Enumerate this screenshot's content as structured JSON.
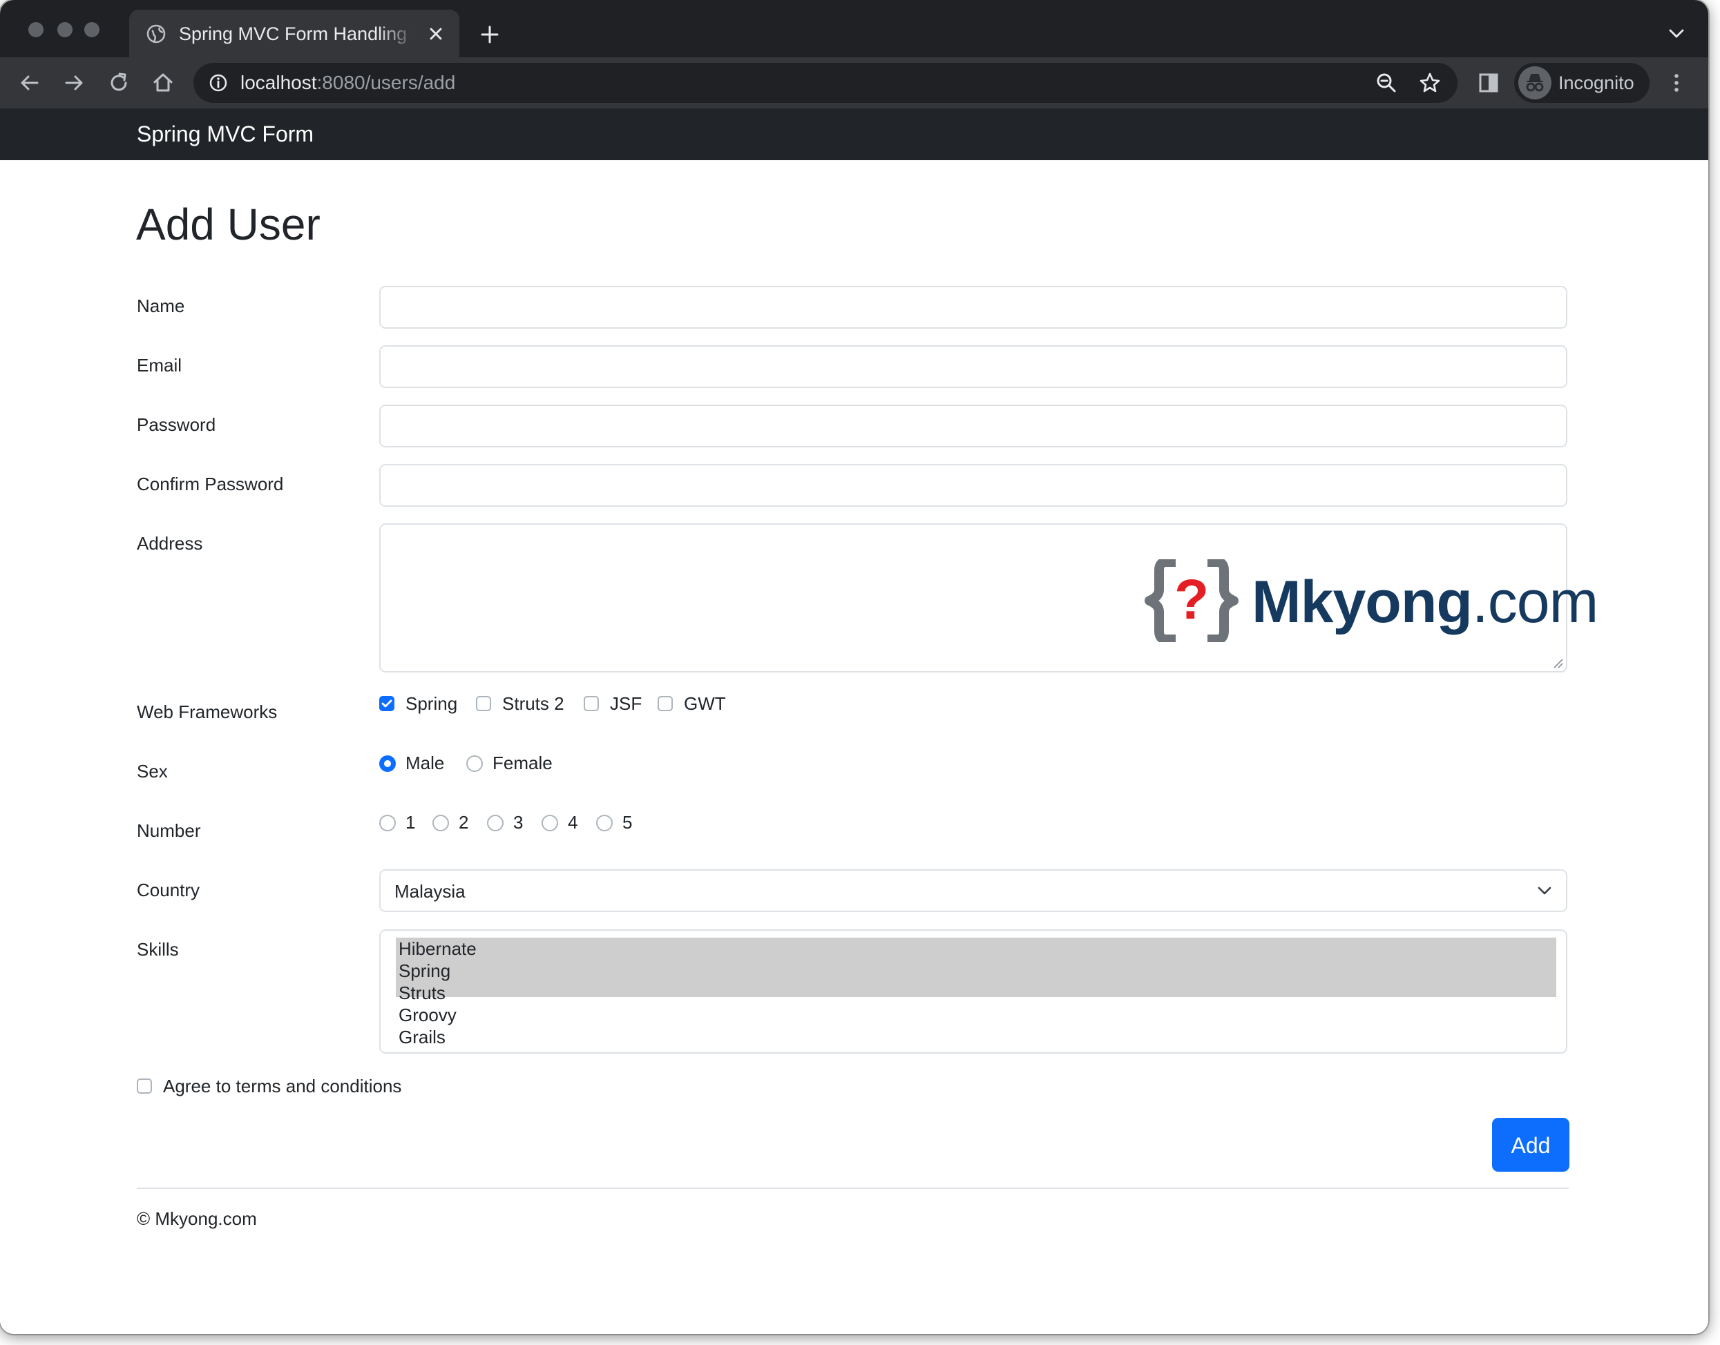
{
  "browser": {
    "tab_title": "Spring MVC Form Handling Example",
    "url_host": "localhost",
    "url_path": ":8080/users/add",
    "profile_label": "Incognito",
    "icons": [
      "back-icon",
      "forward-icon",
      "reload-icon",
      "home-icon",
      "info-icon",
      "zoom-icon",
      "star-icon",
      "side-panel-icon",
      "incognito-icon",
      "menu-icon"
    ]
  },
  "navbar": {
    "brand": "Spring MVC Form"
  },
  "form": {
    "heading": "Add User",
    "name_label": "Name",
    "email_label": "Email",
    "password_label": "Password",
    "confirm_password_label": "Confirm Password",
    "address_label": "Address",
    "frameworks_label": "Web Frameworks",
    "frameworks": [
      {
        "label": "Spring",
        "checked": true
      },
      {
        "label": "Struts 2",
        "checked": false
      },
      {
        "label": "JSF",
        "checked": false
      },
      {
        "label": "GWT",
        "checked": false
      }
    ],
    "sex_label": "Sex",
    "sex_options": [
      {
        "label": "Male",
        "checked": true
      },
      {
        "label": "Female",
        "checked": false
      }
    ],
    "number_label": "Number",
    "numbers": [
      {
        "label": "1",
        "checked": false
      },
      {
        "label": "2",
        "checked": false
      },
      {
        "label": "3",
        "checked": false
      },
      {
        "label": "4",
        "checked": false
      },
      {
        "label": "5",
        "checked": false
      }
    ],
    "country_label": "Country",
    "country_value": "Malaysia",
    "skills_label": "Skills",
    "skills": [
      {
        "label": "Hibernate",
        "selected": true
      },
      {
        "label": "Spring",
        "selected": true
      },
      {
        "label": "Struts",
        "selected": true
      },
      {
        "label": "Groovy",
        "selected": false
      },
      {
        "label": "Grails",
        "selected": false
      }
    ],
    "terms_label": "Agree to terms and conditions",
    "terms_checked": false,
    "submit_label": "Add"
  },
  "watermark": {
    "brand": "Mkyong",
    "tld": ".com",
    "symbol": "?"
  },
  "footer": {
    "text": "© Mkyong.com"
  },
  "colors": {
    "primary": "#0d6efd",
    "navbar": "#212529",
    "logo_blue": "#163a5f",
    "logo_red": "#e31e24"
  }
}
